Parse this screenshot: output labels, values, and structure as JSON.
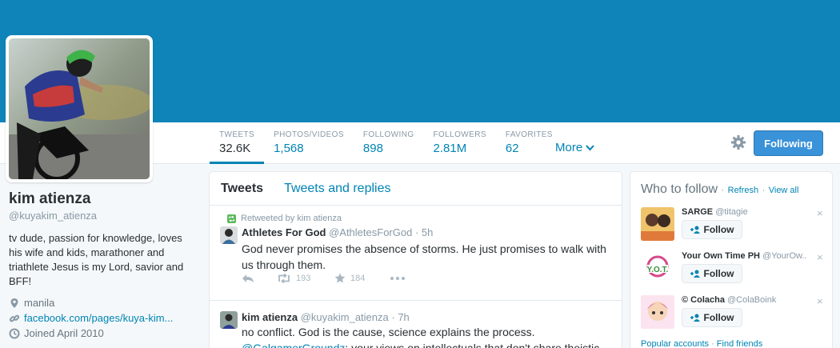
{
  "colors": {
    "accent": "#0084b4",
    "banner": "#0e84b9",
    "follow_button": "#3a92d8"
  },
  "nav": {
    "stats": [
      {
        "label": "TWEETS",
        "value": "32.6K"
      },
      {
        "label": "PHOTOS/VIDEOS",
        "value": "1,568"
      },
      {
        "label": "FOLLOWING",
        "value": "898"
      },
      {
        "label": "FOLLOWERS",
        "value": "2.81M"
      },
      {
        "label": "FAVORITES",
        "value": "62"
      }
    ],
    "more_label": "More",
    "settings_icon": "gear-icon",
    "follow_button": "Following"
  },
  "profile": {
    "name": "kim atienza",
    "handle": "@kuyakim_atienza",
    "bio": "tv dude, passion for knowledge, loves his wife and kids, marathoner and triathlete Jesus is my Lord, savior and BFF!",
    "location": "manila",
    "website": "facebook.com/pages/kuya-kim...",
    "joined": "Joined April 2010"
  },
  "timeline": {
    "tabs": [
      "Tweets",
      "Tweets and replies"
    ],
    "tweets": [
      {
        "retweeted_by": "Retweeted by kim atienza",
        "name": "Athletes For God",
        "handle": "@AthletesForGod",
        "time": "· 5h",
        "text": "God never promises the absence of storms. He just promises to walk with us through them.",
        "retweets": "193",
        "favorites": "184"
      },
      {
        "name": "kim atienza",
        "handle": "@kuyakim_atienza",
        "time": "· 7h",
        "text": "no conflict. God is the cause, science explains the process.",
        "mention": "@GalgamerGroundz",
        "text2": ": your views on intellectuals that don't share theistic"
      }
    ]
  },
  "who_to_follow": {
    "title": "Who to follow",
    "refresh": "Refresh",
    "view_all": "View all",
    "separator": "·",
    "follow_label": "Follow",
    "dismiss": "×",
    "suggestions": [
      {
        "name": "SARGE",
        "handle": "@titagie"
      },
      {
        "name": "Your Own Time PH",
        "handle": "@YourOw.."
      },
      {
        "name": "© Colacha",
        "handle": "@ColaBoink"
      }
    ],
    "footer_popular": "Popular accounts",
    "footer_find": "Find friends"
  }
}
